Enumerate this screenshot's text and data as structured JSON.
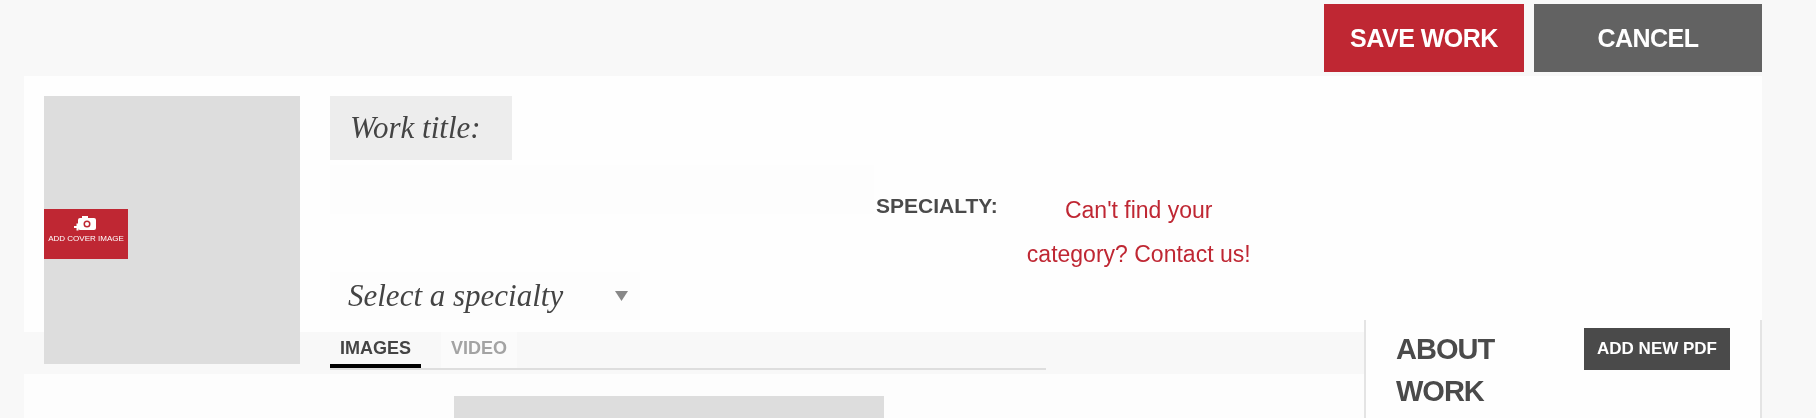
{
  "actions": [
    {
      "label": "SAVE WORK",
      "kind": "primary"
    },
    {
      "label": "CANCEL",
      "kind": "secondary"
    }
  ],
  "cover": {
    "button_label": "ADD COVER IMAGE"
  },
  "title_field": {
    "label": "Work title:"
  },
  "specialty": {
    "label": "SPECIALTY:",
    "help_link": "Can't find your category? Contact us!",
    "select_placeholder": "Select a specialty"
  },
  "media_tabs": [
    {
      "label": "IMAGES",
      "selected": true
    },
    {
      "label": "VIDEO",
      "selected": false
    }
  ],
  "about": {
    "title": "ABOUT WORK",
    "button": "ADD NEW PDF"
  }
}
